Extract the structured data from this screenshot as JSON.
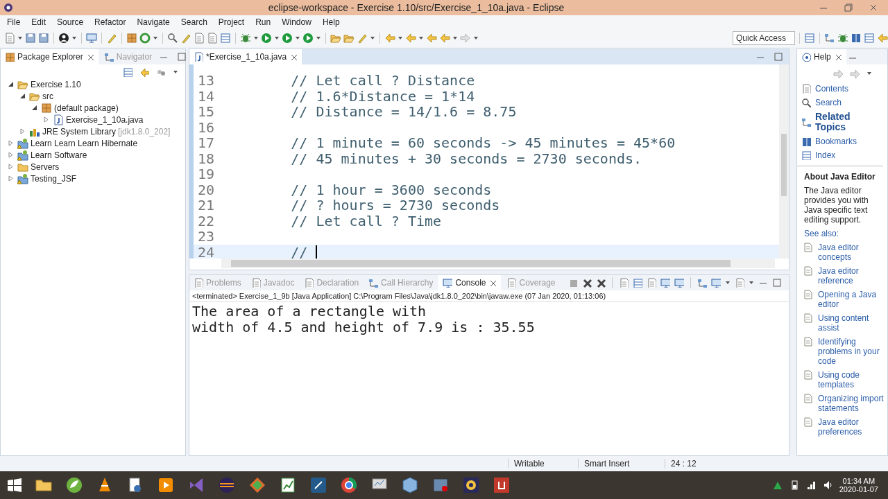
{
  "window": {
    "title": "eclipse-workspace - Exercise 1.10/src/Exercise_1_10a.java - Eclipse"
  },
  "menu": [
    "File",
    "Edit",
    "Source",
    "Refactor",
    "Navigate",
    "Search",
    "Project",
    "Run",
    "Window",
    "Help"
  ],
  "quick_access": {
    "placeholder": "Quick Access"
  },
  "package_explorer": {
    "tabs": [
      {
        "label": "Package Explorer",
        "selected": true
      },
      {
        "label": "Navigator",
        "selected": false
      }
    ],
    "tree": [
      {
        "label": "Exercise 1.10",
        "kind": "project",
        "expanded": true,
        "children": [
          {
            "label": "src",
            "kind": "source",
            "expanded": true,
            "children": [
              {
                "label": "(default package)",
                "kind": "package",
                "expanded": true,
                "children": [
                  {
                    "label": "Exercise_1_10a.java",
                    "kind": "file",
                    "expanded": false
                  }
                ]
              }
            ]
          },
          {
            "label": "JRE System Library",
            "suffix": "[jdk1.8.0_202]",
            "kind": "library",
            "expanded": false
          }
        ]
      },
      {
        "label": "Learn Learn Learn Hibernate",
        "kind": "web_project",
        "expanded": false
      },
      {
        "label": "Learn Software",
        "kind": "web_project",
        "expanded": false
      },
      {
        "label": "Servers",
        "kind": "folder",
        "expanded": false
      },
      {
        "label": "Testing_JSF",
        "kind": "web_project",
        "expanded": false
      }
    ]
  },
  "editor": {
    "tab": {
      "label": "*Exercise_1_10a.java"
    },
    "lines": [
      {
        "number": "13",
        "text": "        // Let call ? Distance",
        "current": false
      },
      {
        "number": "14",
        "text": "        // 1.6*Distance = 1*14",
        "current": false
      },
      {
        "number": "15",
        "text": "        // Distance = 14/1.6 = 8.75",
        "current": false
      },
      {
        "number": "16",
        "current": false
      },
      {
        "number": "17",
        "text": "        // 1 minute = 60 seconds -> 45 minutes = 45*60",
        "current": false
      },
      {
        "number": "18",
        "text": "        // 45 minutes + 30 seconds = 2730 seconds.",
        "current": false
      },
      {
        "number": "19",
        "current": false
      },
      {
        "number": "20",
        "text": "        // 1 hour = 3600 seconds",
        "current": false
      },
      {
        "number": "21",
        "text": "        // ? hours = 2730 seconds",
        "current": false
      },
      {
        "number": "22",
        "text": "        // Let call ? Time",
        "current": false
      },
      {
        "number": "23",
        "current": false
      },
      {
        "number": "24",
        "text": "        // ",
        "current": true
      }
    ]
  },
  "console": {
    "tabs": [
      {
        "label": "Problems",
        "selected": false
      },
      {
        "label": "Javadoc",
        "selected": false
      },
      {
        "label": "Declaration",
        "selected": false
      },
      {
        "label": "Call Hierarchy",
        "selected": false
      },
      {
        "label": "Console",
        "selected": true
      },
      {
        "label": "Coverage",
        "selected": false
      }
    ],
    "status": "<terminated> Exercise_1_9b [Java Application] C:\\Program Files\\Java\\jdk1.8.0_202\\bin\\javaw.exe (07 Jan 2020, 01:13:06)",
    "output": [
      "The area of a rectangle with",
      "width of 4.5 and height of 7.9 is : 35.55"
    ]
  },
  "help": {
    "tab": "Help",
    "nav": [
      {
        "label": "Contents",
        "selected": false
      },
      {
        "label": "Search",
        "selected": false
      },
      {
        "label": "Related Topics",
        "selected": true
      },
      {
        "label": "Bookmarks",
        "selected": false
      },
      {
        "label": "Index",
        "selected": false
      }
    ],
    "heading": "About Java Editor",
    "description": "The Java editor provides you with Java specific text editing support.",
    "see_also": "See also:",
    "links": [
      "Java editor concepts",
      "Java editor reference",
      "Opening a Java editor",
      "Using content assist",
      "Identifying problems in your code",
      "Using code templates",
      "Organizing import statements",
      "Java editor preferences"
    ]
  },
  "status_bar": [
    "Writable",
    "Smart Insert",
    "24 : 12"
  ],
  "taskbar": {
    "time": "01:34 AM",
    "date": "2020-01-07"
  }
}
